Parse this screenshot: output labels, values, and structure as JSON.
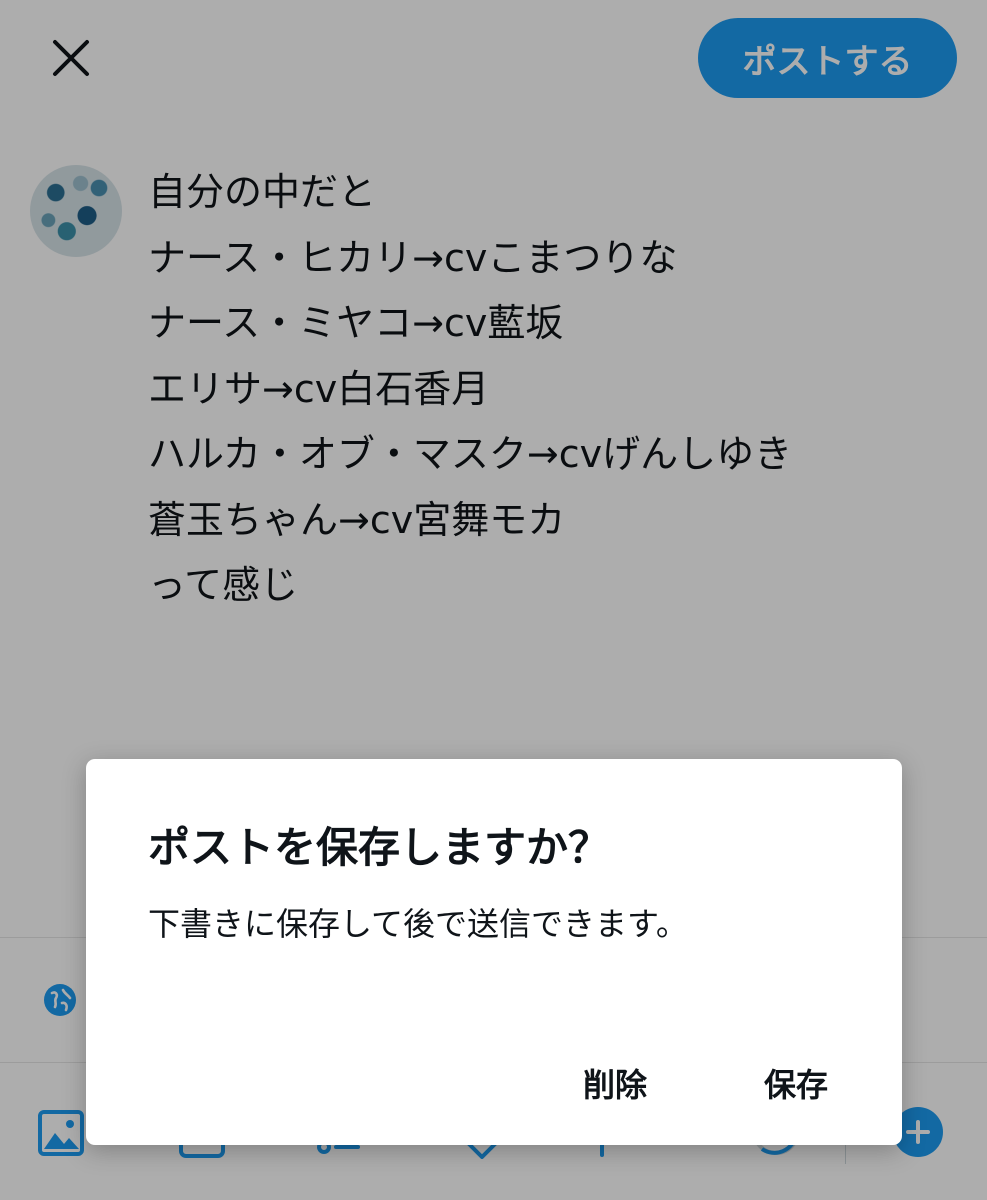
{
  "colors": {
    "accent": "#1d9bf0",
    "text": "#0f1419",
    "scrim": "rgba(0,0,0,0.32)",
    "dialog_bg": "#ffffff"
  },
  "header": {
    "close_icon": "close-icon",
    "post_button_label": "ポストする"
  },
  "composer": {
    "avatar_icon": "avatar",
    "lines": [
      "自分の中だと",
      "ナース・ヒカリ→cvこまつりな",
      "ナース・ミヤコ→cv藍坂",
      "エリサ→cv白石香月",
      "ハルカ・オブ・マスク→cvげんしゆき",
      "蒼玉ちゃん→cv宮舞モカ",
      "って感じ"
    ]
  },
  "reply_setting": {
    "icon": "globe-icon"
  },
  "toolbar": {
    "icons": [
      "image-icon",
      "gif-icon",
      "poll-icon",
      "location-icon",
      "schedule-icon",
      "char-counter-icon",
      "add-post-icon"
    ]
  },
  "dialog": {
    "title": "ポストを保存しますか？",
    "message": "下書きに保存して後で送信できます。",
    "delete_label": "削除",
    "save_label": "保存"
  }
}
